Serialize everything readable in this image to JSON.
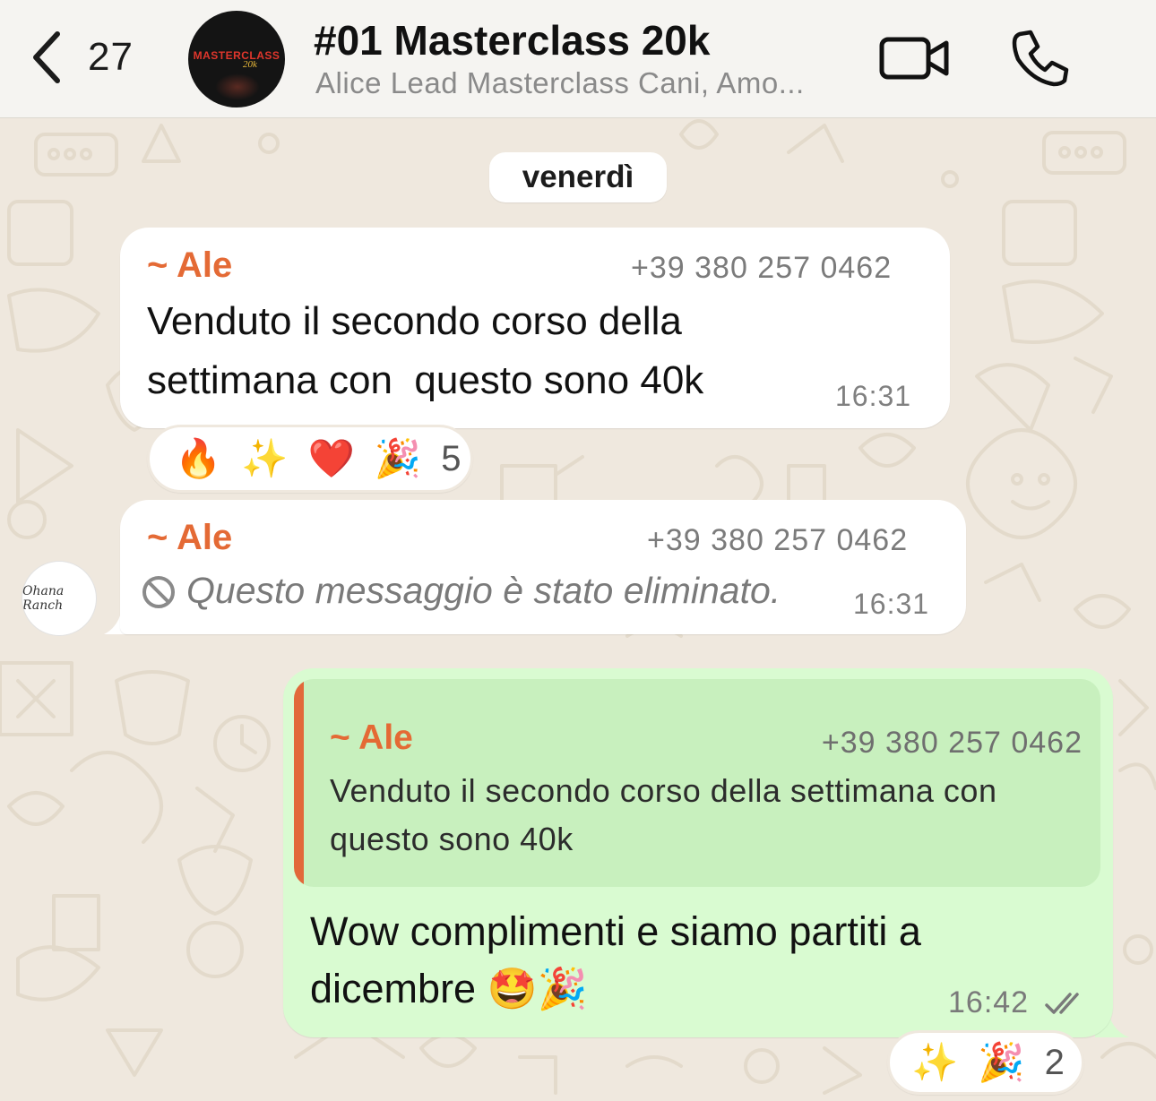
{
  "header": {
    "back_count": "27",
    "group_name": "#01 Masterclass 20k",
    "group_members": "Alice Lead Masterclass Cani, Amo...",
    "avatar_text_line1": "MASTERCLASS",
    "avatar_text_line2": "20k",
    "icons": [
      "chevron-left-icon",
      "video-camera-icon",
      "phone-icon"
    ]
  },
  "date_separator": "venerdì",
  "messages": [
    {
      "type": "incoming",
      "sender": "~ Ale",
      "phone": "+39 380 257 0462",
      "text_line1": "Venduto il secondo corso della",
      "text_line2": "settimana con  questo sono 40k",
      "time": "16:31",
      "reactions": {
        "emojis": [
          "🔥",
          "✨",
          "❤️",
          "🎉"
        ],
        "count": "5"
      }
    },
    {
      "type": "incoming-deleted",
      "sender": "~ Ale",
      "phone": "+39 380 257 0462",
      "text": "Questo messaggio è stato eliminato.",
      "time": "16:31",
      "avatar_text": "Ohana Ranch"
    },
    {
      "type": "outgoing",
      "quote": {
        "sender": "~ Ale",
        "phone": "+39 380 257 0462",
        "text": "Venduto il secondo corso della settimana con questo sono 40k"
      },
      "text_line1": "Wow complimenti e siamo partiti a",
      "text_line2": "dicembre 🤩🎉",
      "time": "16:42",
      "status": "read",
      "reactions": {
        "emojis": [
          "✨",
          "🎉"
        ],
        "count": "2"
      }
    }
  ],
  "colors": {
    "sender_name": "#e46a35",
    "outgoing_bubble": "#d9fbd1",
    "quote_bar": "#e2683a",
    "wallpaper": "#efe8de"
  }
}
